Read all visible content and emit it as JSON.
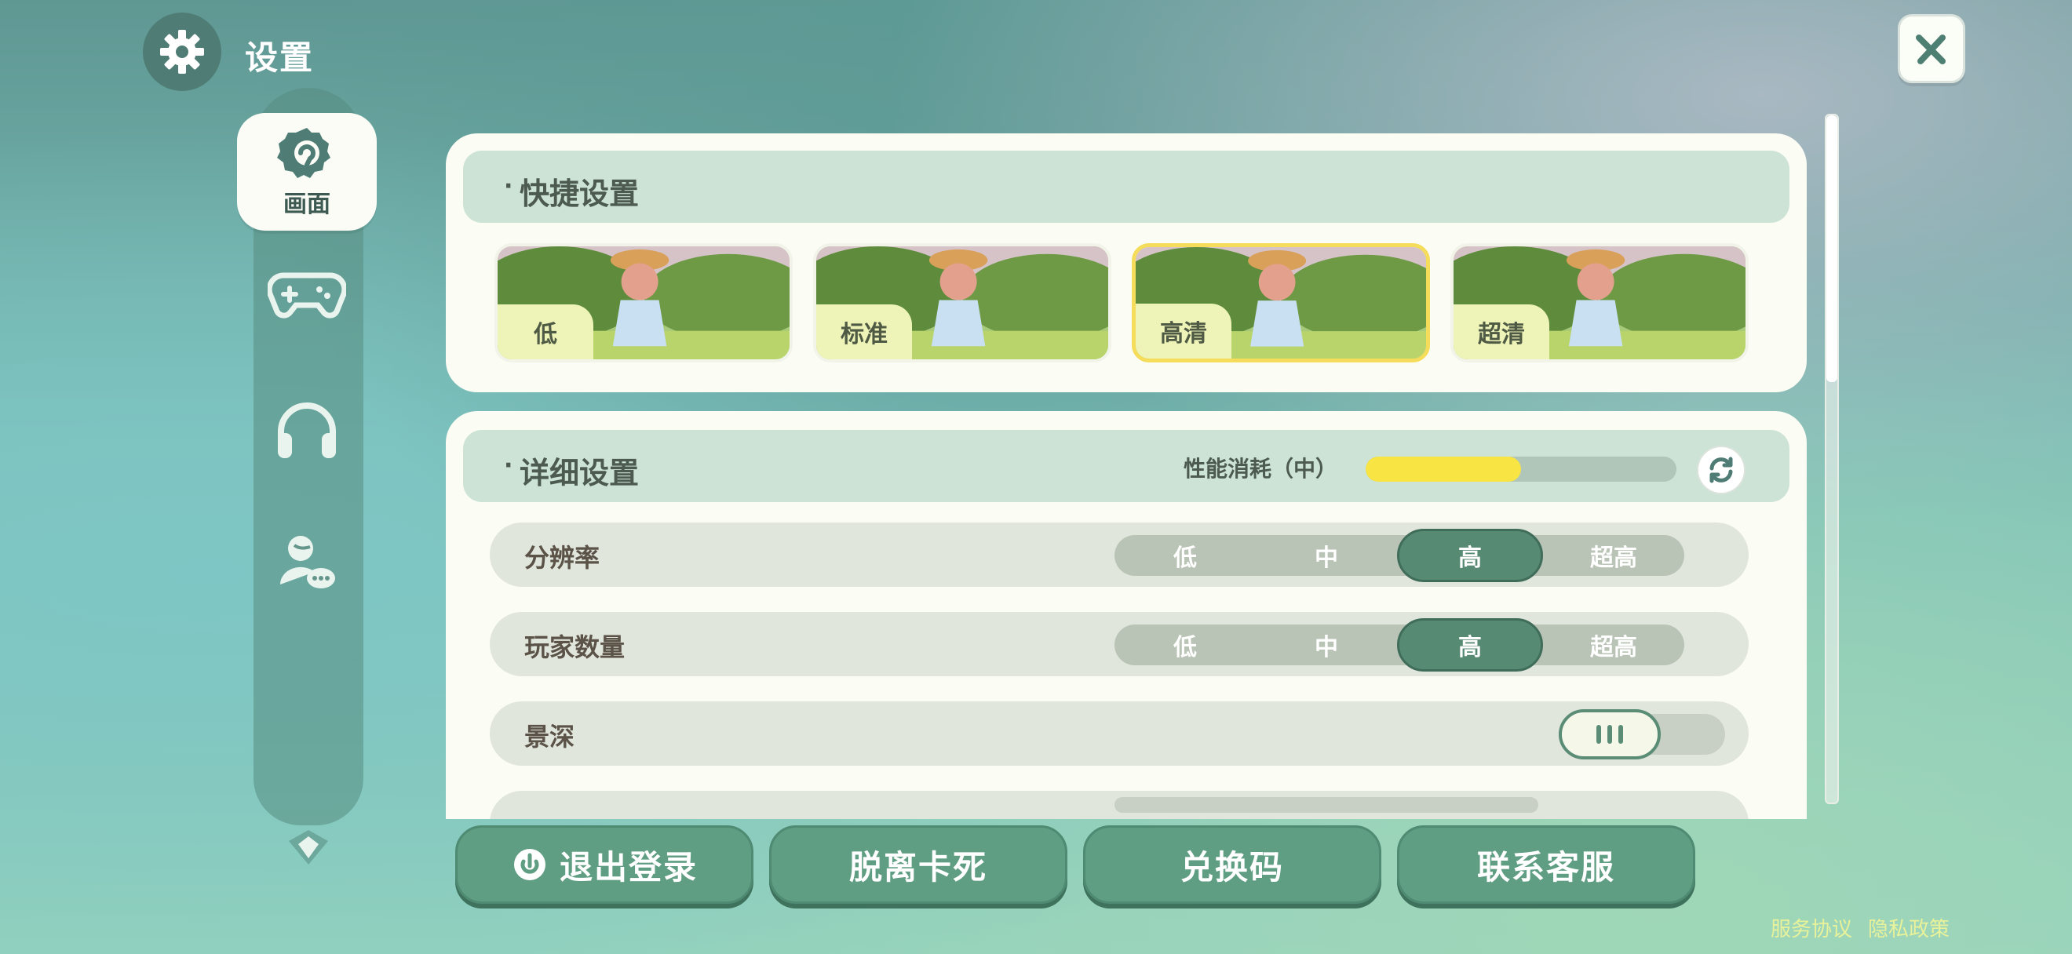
{
  "header": {
    "title": "设置"
  },
  "sidebar": {
    "items": [
      {
        "label": "画面",
        "icon": "display-icon",
        "active": true
      },
      {
        "label": "",
        "icon": "gamepad-icon",
        "active": false
      },
      {
        "label": "",
        "icon": "headphones-icon",
        "active": false
      },
      {
        "label": "",
        "icon": "social-icon",
        "active": false
      }
    ]
  },
  "quick": {
    "title": "快捷设置",
    "presets": [
      {
        "label": "低",
        "selected": false
      },
      {
        "label": "标准",
        "selected": false
      },
      {
        "label": "高清",
        "selected": true
      },
      {
        "label": "超清",
        "selected": false
      }
    ]
  },
  "detail": {
    "title": "详细设置",
    "perf_label": "性能消耗（中）",
    "perf_level": 0.5,
    "resolution": {
      "label": "分辨率",
      "options": [
        "低",
        "中",
        "高",
        "超高"
      ],
      "selected": "高"
    },
    "players": {
      "label": "玩家数量",
      "options": [
        "低",
        "中",
        "高",
        "超高"
      ],
      "selected": "高"
    },
    "depth": {
      "label": "景深",
      "enabled": false
    }
  },
  "bottom": {
    "logout": "退出登录",
    "unstuck": "脱离卡死",
    "redeem": "兑换码",
    "support": "联系客服"
  },
  "footer": {
    "terms": "服务协议",
    "privacy": "隐私政策"
  },
  "colors": {
    "accent": "#5f9e83",
    "selected": "#f5dc5a",
    "perf": "#f8e443"
  }
}
